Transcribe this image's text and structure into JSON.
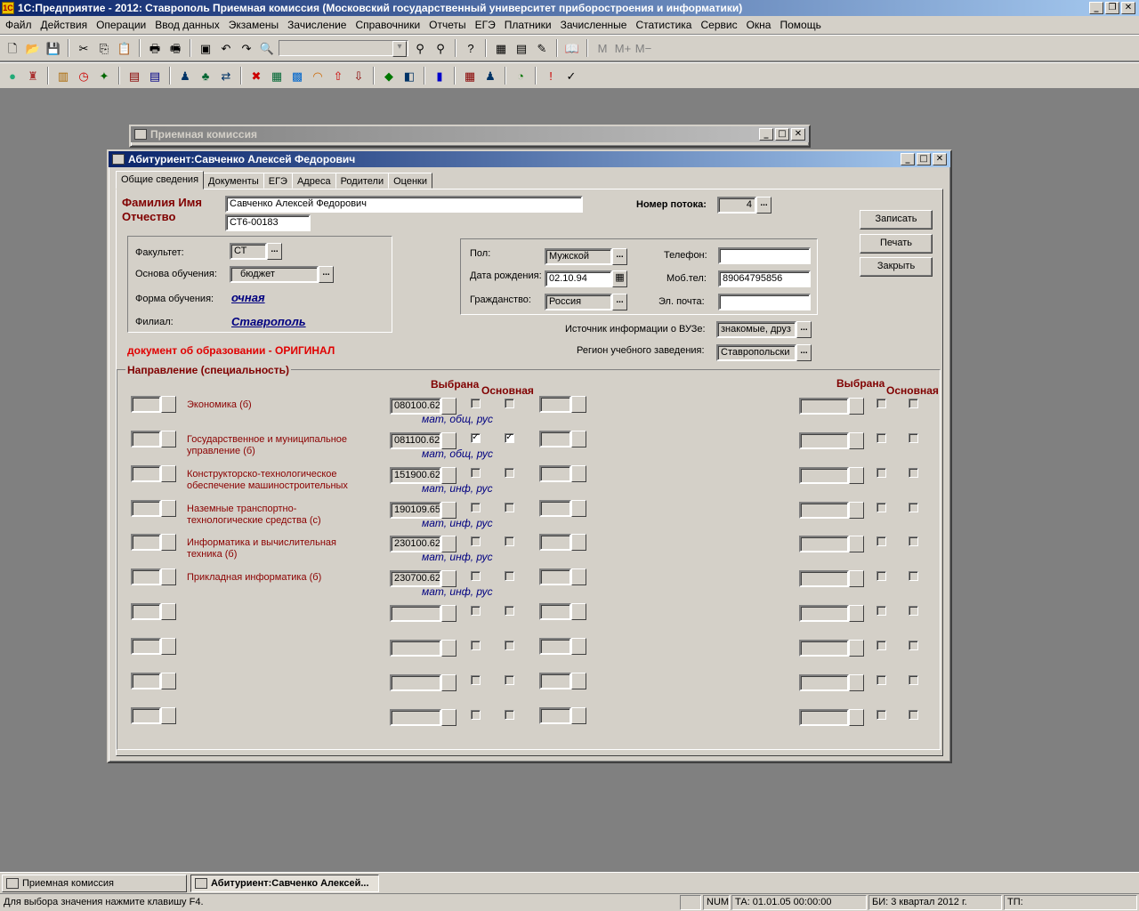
{
  "app": {
    "title": "1С:Предприятие - 2012: Ставрополь Приемная комиссия (Московский государственный университет приборостроения и информатики)",
    "icon_text": "1С"
  },
  "menu": [
    "Файл",
    "Действия",
    "Операции",
    "Ввод данных",
    "Экзамены",
    "Зачисление",
    "Справочники",
    "Отчеты",
    "ЕГЭ",
    "Платники",
    "Зачисленные",
    "Статистика",
    "Сервис",
    "Окна",
    "Помощь"
  ],
  "toolbar1_text": {
    "m": "M",
    "m_plus": "M+",
    "m_minus": "M−"
  },
  "bg_window": {
    "title": "Приемная комиссия"
  },
  "main_window": {
    "title": "Абитуриент:Савченко Алексей Федорович",
    "tabs": [
      "Общие сведения",
      "Документы",
      "ЕГЭ",
      "Адреса",
      "Родители",
      "Оценки"
    ],
    "name_label_line1": "Фамилия Имя",
    "name_label_line2": "Отчество",
    "full_name": "Савченко Алексей Федорович",
    "code": "СТ6-00183",
    "stream_label": "Номер потока:",
    "stream_value": "4",
    "buttons": {
      "save": "Записать",
      "print": "Печать",
      "close": "Закрыть"
    },
    "faculty_label": "Факультет:",
    "faculty_value": "СТ",
    "basis_label": "Основа обучения:",
    "basis_value": "бюджет",
    "form_label": "Форма обучения:",
    "form_value": "очная",
    "branch_label": "Филиал:",
    "branch_value": "Ставрополь",
    "gender_label": "Пол:",
    "gender_value": "Мужской",
    "birth_label": "Дата рождения:",
    "birth_value": "02.10.94",
    "citizen_label": "Гражданство:",
    "citizen_value": "Россия",
    "phone_label": "Телефон:",
    "phone_value": "",
    "mobile_label": "Моб.тел:",
    "mobile_value": "89064795856",
    "email_label": "Эл. почта:",
    "email_value": "",
    "source_label": "Источник информации о ВУЗе:",
    "source_value": "знакомые, друз",
    "region_label": "Регион учебного заведения:",
    "region_value": "Ставропольски",
    "doc_notice": "документ об образовании - ОРИГИНАЛ",
    "directions_group_label": "Направление (специальность)",
    "col_chosen": "Выбрана",
    "col_main": "Основная",
    "directions": [
      {
        "name": "Экономика (б)",
        "code": "080100.62",
        "subjects": "мат, общ, рус",
        "chosen": false,
        "main": false
      },
      {
        "name": "Государственное и муниципальное управление (б)",
        "code": "081100.62",
        "subjects": "мат, общ, рус",
        "chosen": true,
        "main": true
      },
      {
        "name": "Конструкторско-технологическое обеспечение машиностроительных производств (б)",
        "code": "151900.62",
        "subjects": "мат, инф, рус",
        "chosen": false,
        "main": false
      },
      {
        "name": "Наземные транспортно-технологические средства (с)",
        "code": "190109.65",
        "subjects": "мат, инф, рус",
        "chosen": false,
        "main": false
      },
      {
        "name": "Информатика и вычислительная техника (б)",
        "code": "230100.62",
        "subjects": "мат, инф, рус",
        "chosen": false,
        "main": false
      },
      {
        "name": "Прикладная информатика (б)",
        "code": "230700.62",
        "subjects": "мат, инф, рус",
        "chosen": false,
        "main": false
      },
      {
        "name": "",
        "code": "",
        "subjects": "",
        "chosen": false,
        "main": false
      },
      {
        "name": "",
        "code": "",
        "subjects": "",
        "chosen": false,
        "main": false
      },
      {
        "name": "",
        "code": "",
        "subjects": "",
        "chosen": false,
        "main": false
      },
      {
        "name": "",
        "code": "",
        "subjects": "",
        "chosen": false,
        "main": false
      }
    ]
  },
  "taskbar": {
    "task1": "Приемная комиссия",
    "task2": "Абитуриент:Савченко Алексей..."
  },
  "status": {
    "hint": "Для выбора значения нажмите клавишу F4.",
    "num": "NUM",
    "ta": "ТА: 01.01.05  00:00:00",
    "bi": "БИ: 3 квартал 2012 г.",
    "tp": "ТП:"
  }
}
